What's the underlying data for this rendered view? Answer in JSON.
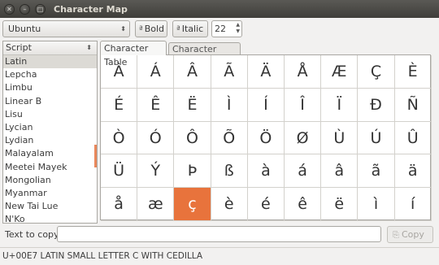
{
  "window": {
    "title": "Character Map"
  },
  "toolbar": {
    "font": "Ubuntu",
    "bold_label": "Bold",
    "italic_label": "Italic",
    "size": "22"
  },
  "sidebar": {
    "header": "Script",
    "items": [
      "Latin",
      "Lepcha",
      "Limbu",
      "Linear B",
      "Lisu",
      "Lycian",
      "Lydian",
      "Malayalam",
      "Meetei Mayek",
      "Mongolian",
      "Myanmar",
      "New Tai Lue",
      "N'Ko"
    ],
    "selected": "Latin"
  },
  "tabs": [
    "Character Table",
    "Character Details"
  ],
  "grid": {
    "rows": [
      [
        "À",
        "Á",
        "Â",
        "Ã",
        "Ä",
        "Å",
        "Æ",
        "Ç",
        "È"
      ],
      [
        "É",
        "Ê",
        "Ë",
        "Ì",
        "Í",
        "Î",
        "Ï",
        "Đ",
        "Ñ"
      ],
      [
        "Ò",
        "Ó",
        "Ô",
        "Õ",
        "Ö",
        "Ø",
        "Ù",
        "Ú",
        "Û"
      ],
      [
        "Ü",
        "Ý",
        "Þ",
        "ß",
        "à",
        "á",
        "â",
        "ã",
        "ä"
      ],
      [
        "å",
        "æ",
        "ç",
        "è",
        "é",
        "ê",
        "ë",
        "ì",
        "í"
      ]
    ],
    "selected": "ç"
  },
  "copy": {
    "label": "Text to copy:",
    "value": "",
    "button": "Copy"
  },
  "status": "U+00E7 LATIN SMALL LETTER C WITH CEDILLA",
  "colors": {
    "accent": "#e8733c",
    "titlebar": "#3f3e3a"
  }
}
